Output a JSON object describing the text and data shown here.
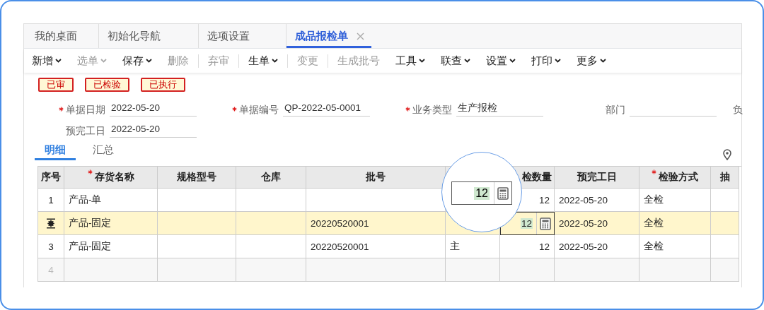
{
  "tabs": [
    {
      "label": "我的桌面",
      "selected": false,
      "closable": false
    },
    {
      "label": "初始化导航",
      "selected": false,
      "closable": false
    },
    {
      "label": "选项设置",
      "selected": false,
      "closable": false
    },
    {
      "label": "成品报检单",
      "selected": true,
      "closable": true
    }
  ],
  "toolbar": [
    {
      "label": "新增",
      "dropdown": true,
      "disabled": false,
      "divider_before": false
    },
    {
      "label": "选单",
      "dropdown": true,
      "disabled": true,
      "divider_before": false
    },
    {
      "label": "保存",
      "dropdown": true,
      "disabled": false,
      "divider_before": false
    },
    {
      "label": "删除",
      "dropdown": false,
      "disabled": true,
      "divider_before": false
    },
    {
      "label": "弃审",
      "dropdown": false,
      "disabled": true,
      "divider_before": true
    },
    {
      "label": "生单",
      "dropdown": true,
      "disabled": false,
      "divider_before": true
    },
    {
      "label": "变更",
      "dropdown": false,
      "disabled": true,
      "divider_before": true
    },
    {
      "label": "生成批号",
      "dropdown": false,
      "disabled": true,
      "divider_before": true
    },
    {
      "label": "工具",
      "dropdown": true,
      "disabled": false,
      "divider_before": false
    },
    {
      "label": "联查",
      "dropdown": true,
      "disabled": false,
      "divider_before": false
    },
    {
      "label": "设置",
      "dropdown": true,
      "disabled": false,
      "divider_before": false
    },
    {
      "label": "打印",
      "dropdown": true,
      "disabled": false,
      "divider_before": false
    },
    {
      "label": "更多",
      "dropdown": true,
      "disabled": false,
      "divider_before": false
    }
  ],
  "status_tags": [
    "已审",
    "已检验",
    "已执行"
  ],
  "form_rows": [
    [
      {
        "label": "单据日期",
        "required": true,
        "value": "2022-05-20"
      },
      {
        "label": "单据编号",
        "required": true,
        "value": "QP-2022-05-0001"
      },
      {
        "label": "业务类型",
        "required": true,
        "value": "生产报检"
      },
      {
        "label": "部门",
        "required": false
      },
      {
        "label": "负",
        "kind": "cut"
      }
    ],
    [
      {
        "label": "预完工日",
        "required": false,
        "value": "2022-05-20"
      }
    ]
  ],
  "sub_tabs": [
    {
      "label": "明细",
      "selected": true
    },
    {
      "label": "汇总",
      "selected": false
    }
  ],
  "table": {
    "columns": [
      {
        "label": "序号",
        "required": false
      },
      {
        "label": "存货名称",
        "required": true
      },
      {
        "label": "规格型号",
        "required": false
      },
      {
        "label": "仓库",
        "required": false
      },
      {
        "label": "批号",
        "required": false
      },
      {},
      {
        "label": "检数量",
        "required": false
      },
      {
        "label": "预完工日",
        "required": false
      },
      {
        "label": "检验方式",
        "required": true
      },
      {
        "label": "抽",
        "required": false
      }
    ],
    "rows": [
      {
        "selected": false,
        "empty": false,
        "cells": [
          "1",
          "产品-单",
          "",
          "",
          "",
          "",
          "12",
          "2022-05-20",
          "全检",
          ""
        ]
      },
      {
        "selected": true,
        "empty": false,
        "cells": [
          "",
          "产品-固定",
          "",
          "",
          "20220520001",
          "",
          "12",
          "2022-05-20",
          "全检",
          ""
        ]
      },
      {
        "selected": false,
        "empty": false,
        "cells": [
          "3",
          "产品-固定",
          "",
          "",
          "20220520001",
          "主",
          "12",
          "2022-05-20",
          "全检",
          ""
        ]
      },
      {
        "selected": false,
        "empty": true,
        "cells": [
          "4",
          "",
          "",
          "",
          "",
          "",
          "",
          "",
          "",
          ""
        ]
      }
    ]
  },
  "magnifier": {
    "value": "12"
  }
}
